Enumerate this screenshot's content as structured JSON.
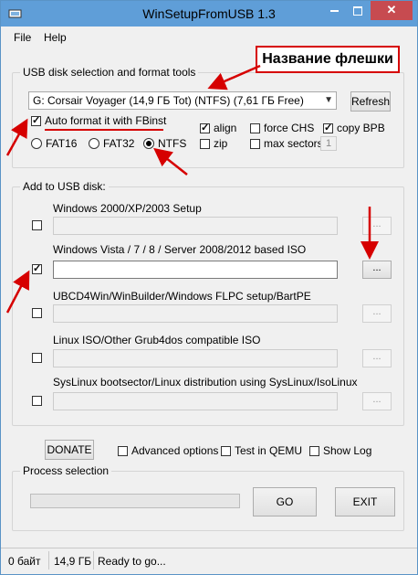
{
  "window": {
    "title": "WinSetupFromUSB 1.3"
  },
  "menu": {
    "file": "File",
    "help": "Help"
  },
  "usb_group": {
    "legend": "USB disk selection and format tools",
    "disk_selected": "G: Corsair Voyager (14,9 ГБ Tot) (NTFS) (7,61 ГБ Free)",
    "refresh": "Refresh",
    "auto_format": "Auto format it with FBinst",
    "fat16": "FAT16",
    "fat32": "FAT32",
    "ntfs": "NTFS",
    "align": "align",
    "zip": "zip",
    "force_chs": "force CHS",
    "max_sectors": "max sectors",
    "max_sectors_value": "1",
    "copy_bpb": "copy BPB"
  },
  "add_group": {
    "legend": "Add to USB disk:",
    "items": [
      {
        "label": "Windows 2000/XP/2003 Setup",
        "checked": false
      },
      {
        "label": "Windows Vista / 7 / 8 / Server 2008/2012 based ISO",
        "checked": true
      },
      {
        "label": "UBCD4Win/WinBuilder/Windows FLPC setup/BartPE",
        "checked": false
      },
      {
        "label": "Linux ISO/Other Grub4dos compatible ISO",
        "checked": false
      },
      {
        "label": "SysLinux bootsector/Linux distribution using SysLinux/IsoLinux",
        "checked": false
      }
    ],
    "browse": "..."
  },
  "bottom": {
    "donate": "DONATE",
    "advanced": "Advanced options",
    "test_qemu": "Test in QEMU",
    "show_log": "Show Log"
  },
  "process": {
    "legend": "Process selection",
    "go": "GO",
    "exit": "EXIT"
  },
  "status": {
    "cell1": "0 байт",
    "cell2": "14,9 ГБ",
    "cell3": "Ready to go..."
  },
  "annotation": {
    "callout": "Название флешки"
  },
  "colors": {
    "titlebar": "#5f9ed8",
    "accent_red": "#d60000"
  }
}
